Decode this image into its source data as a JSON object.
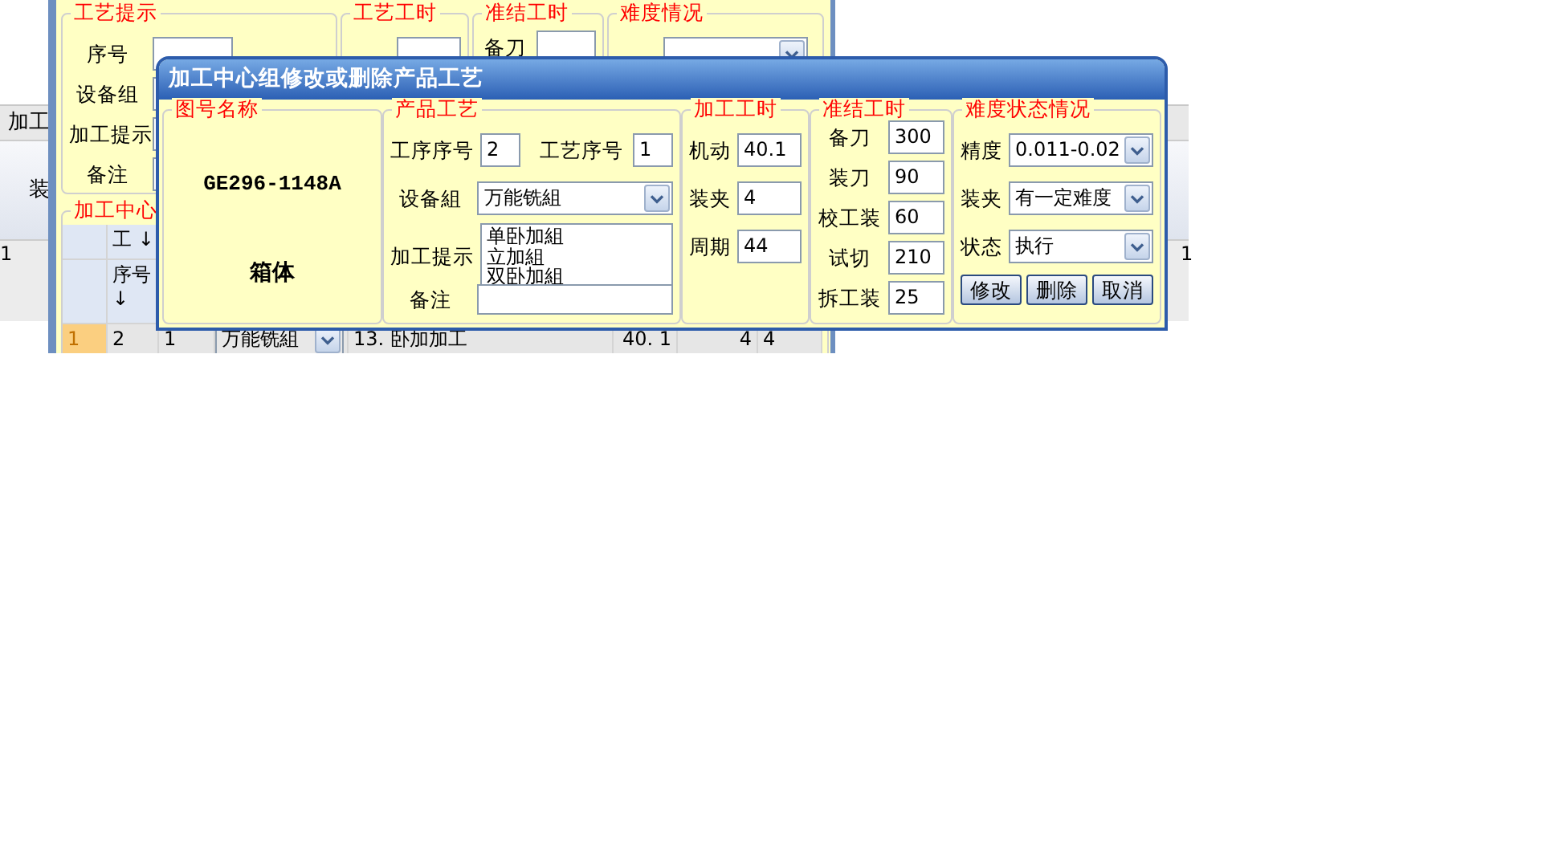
{
  "back_grid": {
    "header": "加工",
    "column_label": "装",
    "left_cell": "1",
    "right_cell": "1"
  },
  "main_form": {
    "tip_group": {
      "legend": "工艺提示",
      "labels": [
        "序号",
        "设备组",
        "加工提示",
        "备注"
      ]
    },
    "time_group": {
      "legend": "工艺工时"
    },
    "setup_group": {
      "legend": "准结工时",
      "labels": [
        "备刀"
      ]
    },
    "difficulty_group": {
      "legend": "难度情况"
    },
    "grid": {
      "legend": "加工中心",
      "column_groups": [
        "工 ↓"
      ],
      "columns": [
        "序号 ↓"
      ],
      "rows": [
        {
          "header": "1",
          "selected": true,
          "cells": [
            "2",
            "1",
            "万能铣組",
            "13. 卧加加工",
            "40. 1",
            "4",
            "4"
          ]
        }
      ]
    }
  },
  "dialog": {
    "title": "加工中心组修改或删除产品工艺",
    "drawing": {
      "legend": "图号名称",
      "number": "GE296-1148A",
      "name": "箱体"
    },
    "process": {
      "legend": "产品工艺",
      "step_no": {
        "label": "工序序号",
        "value": "2"
      },
      "process_no": {
        "label": "工艺序号",
        "value": "1"
      },
      "equipment_group": {
        "label": "设备組",
        "value": "万能铣組"
      },
      "hint": {
        "label": "加工提示",
        "lines": [
          "单卧加組",
          "立加組",
          "双卧加組"
        ]
      },
      "remark": {
        "label": "备注"
      }
    },
    "machining_time": {
      "legend": "加工工时",
      "fields": [
        {
          "label": "机动",
          "value": "40.1"
        },
        {
          "label": "装夹",
          "value": "4"
        },
        {
          "label": "周期",
          "value": "44"
        }
      ]
    },
    "setup_time": {
      "legend": "准结工时",
      "fields": [
        {
          "label": "备刀",
          "value": "300"
        },
        {
          "label": "装刀",
          "value": "90"
        },
        {
          "label": "校工装",
          "value": "60"
        },
        {
          "label": "试切",
          "value": "210"
        },
        {
          "label": "拆工装",
          "value": "25"
        }
      ]
    },
    "difficulty": {
      "legend": "难度状态情况",
      "selects": [
        {
          "label": "精度",
          "value": "0.011-0.02"
        },
        {
          "label": "装夹",
          "value": "有一定难度"
        },
        {
          "label": "状态",
          "value": "执行"
        }
      ]
    },
    "buttons": [
      "修改",
      "删除",
      "取消"
    ]
  }
}
